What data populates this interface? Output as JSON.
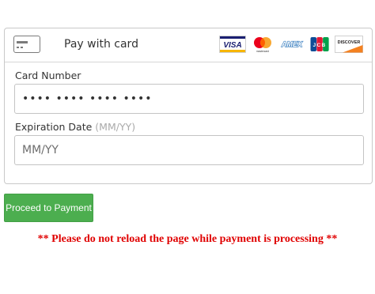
{
  "header": {
    "title": "Pay with card",
    "card_icon": "credit-card-icon",
    "brands": [
      {
        "name": "visa",
        "label": "VISA"
      },
      {
        "name": "mastercard",
        "label": "mastercard"
      },
      {
        "name": "amex",
        "label": "AMEX"
      },
      {
        "name": "jcb",
        "label": "JCB"
      },
      {
        "name": "discover",
        "label": "DISCOVER"
      }
    ]
  },
  "card_number": {
    "label": "Card Number",
    "value": "•••• •••• •••• ••••"
  },
  "expiration": {
    "label": "Expiration Date",
    "hint": "(MM/YY)",
    "placeholder": "MM/YY",
    "value": ""
  },
  "button": {
    "label": "Proceed to Payment"
  },
  "warning": {
    "text": "** Please do not reload the page while payment is processing **"
  },
  "colors": {
    "button": "#4cae4f",
    "warning": "#e00000",
    "visa_blue": "#1a1f71",
    "visa_gold": "#f7b600",
    "mastercard_red": "#eb001b",
    "mastercard_orange": "#f79e1b",
    "amex_blue": "#2e77bc",
    "discover_orange": "#f48120"
  }
}
